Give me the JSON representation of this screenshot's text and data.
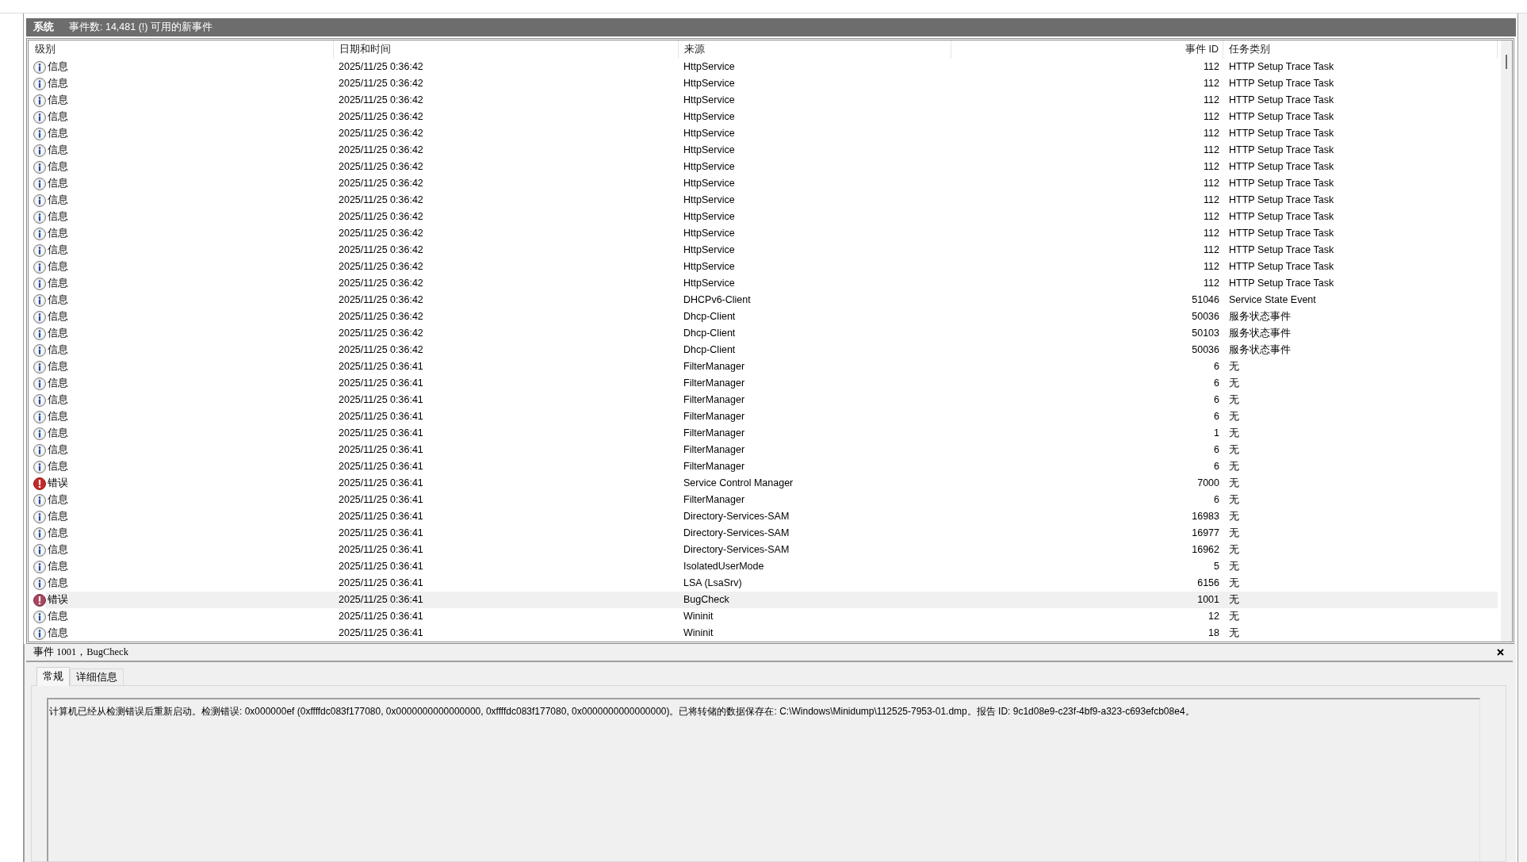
{
  "log_header": {
    "title": "系统",
    "summary": "事件数: 14,481 (!) 可用的新事件"
  },
  "table": {
    "columns": [
      {
        "label": "级别",
        "kind": "level"
      },
      {
        "label": "日期和时间",
        "kind": "text"
      },
      {
        "label": "来源",
        "kind": "text"
      },
      {
        "label": "事件 ID",
        "kind": "number"
      },
      {
        "label": "任务类别",
        "kind": "text"
      }
    ],
    "rows": [
      {
        "kind": "info",
        "selected": false,
        "cells": [
          "信息",
          "2025/11/25 0:36:42",
          "HttpService",
          "112",
          "HTTP Setup Trace Task"
        ]
      },
      {
        "kind": "info",
        "selected": false,
        "cells": [
          "信息",
          "2025/11/25 0:36:42",
          "HttpService",
          "112",
          "HTTP Setup Trace Task"
        ]
      },
      {
        "kind": "info",
        "selected": false,
        "cells": [
          "信息",
          "2025/11/25 0:36:42",
          "HttpService",
          "112",
          "HTTP Setup Trace Task"
        ]
      },
      {
        "kind": "info",
        "selected": false,
        "cells": [
          "信息",
          "2025/11/25 0:36:42",
          "HttpService",
          "112",
          "HTTP Setup Trace Task"
        ]
      },
      {
        "kind": "info",
        "selected": false,
        "cells": [
          "信息",
          "2025/11/25 0:36:42",
          "HttpService",
          "112",
          "HTTP Setup Trace Task"
        ]
      },
      {
        "kind": "info",
        "selected": false,
        "cells": [
          "信息",
          "2025/11/25 0:36:42",
          "HttpService",
          "112",
          "HTTP Setup Trace Task"
        ]
      },
      {
        "kind": "info",
        "selected": false,
        "cells": [
          "信息",
          "2025/11/25 0:36:42",
          "HttpService",
          "112",
          "HTTP Setup Trace Task"
        ]
      },
      {
        "kind": "info",
        "selected": false,
        "cells": [
          "信息",
          "2025/11/25 0:36:42",
          "HttpService",
          "112",
          "HTTP Setup Trace Task"
        ]
      },
      {
        "kind": "info",
        "selected": false,
        "cells": [
          "信息",
          "2025/11/25 0:36:42",
          "HttpService",
          "112",
          "HTTP Setup Trace Task"
        ]
      },
      {
        "kind": "info",
        "selected": false,
        "cells": [
          "信息",
          "2025/11/25 0:36:42",
          "HttpService",
          "112",
          "HTTP Setup Trace Task"
        ]
      },
      {
        "kind": "info",
        "selected": false,
        "cells": [
          "信息",
          "2025/11/25 0:36:42",
          "HttpService",
          "112",
          "HTTP Setup Trace Task"
        ]
      },
      {
        "kind": "info",
        "selected": false,
        "cells": [
          "信息",
          "2025/11/25 0:36:42",
          "HttpService",
          "112",
          "HTTP Setup Trace Task"
        ]
      },
      {
        "kind": "info",
        "selected": false,
        "cells": [
          "信息",
          "2025/11/25 0:36:42",
          "HttpService",
          "112",
          "HTTP Setup Trace Task"
        ]
      },
      {
        "kind": "info",
        "selected": false,
        "cells": [
          "信息",
          "2025/11/25 0:36:42",
          "HttpService",
          "112",
          "HTTP Setup Trace Task"
        ]
      },
      {
        "kind": "info",
        "selected": false,
        "cells": [
          "信息",
          "2025/11/25 0:36:42",
          "DHCPv6-Client",
          "51046",
          "Service State Event"
        ]
      },
      {
        "kind": "info",
        "selected": false,
        "cells": [
          "信息",
          "2025/11/25 0:36:42",
          "Dhcp-Client",
          "50036",
          "服务状态事件"
        ]
      },
      {
        "kind": "info",
        "selected": false,
        "cells": [
          "信息",
          "2025/11/25 0:36:42",
          "Dhcp-Client",
          "50103",
          "服务状态事件"
        ]
      },
      {
        "kind": "info",
        "selected": false,
        "cells": [
          "信息",
          "2025/11/25 0:36:42",
          "Dhcp-Client",
          "50036",
          "服务状态事件"
        ]
      },
      {
        "kind": "info",
        "selected": false,
        "cells": [
          "信息",
          "2025/11/25 0:36:41",
          "FilterManager",
          "6",
          "无"
        ]
      },
      {
        "kind": "info",
        "selected": false,
        "cells": [
          "信息",
          "2025/11/25 0:36:41",
          "FilterManager",
          "6",
          "无"
        ]
      },
      {
        "kind": "info",
        "selected": false,
        "cells": [
          "信息",
          "2025/11/25 0:36:41",
          "FilterManager",
          "6",
          "无"
        ]
      },
      {
        "kind": "info",
        "selected": false,
        "cells": [
          "信息",
          "2025/11/25 0:36:41",
          "FilterManager",
          "6",
          "无"
        ]
      },
      {
        "kind": "info",
        "selected": false,
        "cells": [
          "信息",
          "2025/11/25 0:36:41",
          "FilterManager",
          "1",
          "无"
        ]
      },
      {
        "kind": "info",
        "selected": false,
        "cells": [
          "信息",
          "2025/11/25 0:36:41",
          "FilterManager",
          "6",
          "无"
        ]
      },
      {
        "kind": "info",
        "selected": false,
        "cells": [
          "信息",
          "2025/11/25 0:36:41",
          "FilterManager",
          "6",
          "无"
        ]
      },
      {
        "kind": "error",
        "selected": false,
        "cells": [
          "错误",
          "2025/11/25 0:36:41",
          "Service Control Manager",
          "7000",
          "无"
        ]
      },
      {
        "kind": "info",
        "selected": false,
        "cells": [
          "信息",
          "2025/11/25 0:36:41",
          "FilterManager",
          "6",
          "无"
        ]
      },
      {
        "kind": "info",
        "selected": false,
        "cells": [
          "信息",
          "2025/11/25 0:36:41",
          "Directory-Services-SAM",
          "16983",
          "无"
        ]
      },
      {
        "kind": "info",
        "selected": false,
        "cells": [
          "信息",
          "2025/11/25 0:36:41",
          "Directory-Services-SAM",
          "16977",
          "无"
        ]
      },
      {
        "kind": "info",
        "selected": false,
        "cells": [
          "信息",
          "2025/11/25 0:36:41",
          "Directory-Services-SAM",
          "16962",
          "无"
        ]
      },
      {
        "kind": "info",
        "selected": false,
        "cells": [
          "信息",
          "2025/11/25 0:36:41",
          "IsolatedUserMode",
          "5",
          "无"
        ]
      },
      {
        "kind": "info",
        "selected": false,
        "cells": [
          "信息",
          "2025/11/25 0:36:41",
          "LSA (LsaSrv)",
          "6156",
          "无"
        ]
      },
      {
        "kind": "error",
        "selected": true,
        "cells": [
          "错误",
          "2025/11/25 0:36:41",
          "BugCheck",
          "1001",
          "无"
        ]
      },
      {
        "kind": "info",
        "selected": false,
        "cells": [
          "信息",
          "2025/11/25 0:36:41",
          "Wininit",
          "12",
          "无"
        ]
      },
      {
        "kind": "info",
        "selected": false,
        "cells": [
          "信息",
          "2025/11/25 0:36:41",
          "Wininit",
          "18",
          "无"
        ]
      }
    ]
  },
  "details": {
    "title": "事件 1001，BugCheck",
    "tabs": [
      {
        "label": "常规",
        "selected": true
      },
      {
        "label": "详细信息",
        "selected": false
      }
    ],
    "description": "计算机已经从检测错误后重新启动。检测错误: 0x000000ef (0xffffdc083f177080, 0x0000000000000000, 0xffffdc083f177080, 0x0000000000000000)。已将转储的数据保存在: C:\\Windows\\Minidump\\112525-7953-01.dmp。报告 ID: 9c1d08e9-c23f-4bf9-a323-c693efcb08e4。"
  }
}
